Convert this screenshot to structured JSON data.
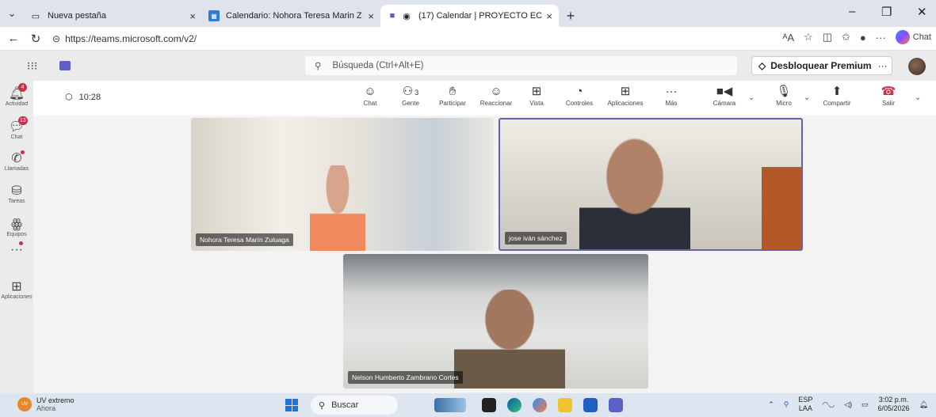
{
  "browser": {
    "tabs": [
      {
        "title": "Nueva pestaña",
        "icon": "page-icon"
      },
      {
        "title": "Calendario: Nohora Teresa Marin Z",
        "icon": "calendar-icon"
      },
      {
        "title": "(17) Calendar | PROYECTO EC",
        "icon": "teams-icon"
      }
    ],
    "url": "https://teams.microsoft.com/v2/",
    "chat_label": "Chat"
  },
  "teams": {
    "search_placeholder": "Búsqueda (Ctrl+Alt+E)",
    "premium_label": "Desbloquear Premium",
    "more_label": "···"
  },
  "rail": [
    {
      "label": "Actividad",
      "icon": "bell-icon",
      "badge": "4"
    },
    {
      "label": "Chat",
      "icon": "chat-icon",
      "badge": "13"
    },
    {
      "label": "Llamadas",
      "icon": "phone-icon",
      "badge": ""
    },
    {
      "label": "Tareas",
      "icon": "tasks-icon",
      "badge": ""
    },
    {
      "label": "Equipos",
      "icon": "teams-icon",
      "badge": ""
    },
    {
      "label": "",
      "icon": "more-icon",
      "badge": ""
    },
    {
      "label": "Aplicaciones",
      "icon": "apps-icon",
      "badge": ""
    }
  ],
  "meeting": {
    "time": "10:28",
    "people_count": "3",
    "buttons": {
      "chat": "Chat",
      "people": "Gente",
      "raise": "Participar",
      "react": "Reaccionar",
      "view": "Vista",
      "controls": "Controles",
      "apps": "Aplicaciones",
      "more": "Más",
      "camera": "Cámara",
      "mic": "Micro",
      "share": "Compartir",
      "leave": "Salir"
    }
  },
  "participants": [
    {
      "name": "Nohora Teresa Marín Zuluaga"
    },
    {
      "name": "jose iván sánchez"
    },
    {
      "name": "Nelson Humberto Zambrano Cortes"
    }
  ],
  "taskbar": {
    "weather_title": "UV extremo",
    "weather_sub": "Ahora",
    "weather_badge": "UV",
    "search": "Buscar",
    "lang_top": "ESP",
    "lang_bottom": "LAA",
    "time": "3:02 p.m.",
    "date": "6/05/2026"
  },
  "colors": {
    "accent": "#6264a7",
    "badge": "#c4314b"
  }
}
